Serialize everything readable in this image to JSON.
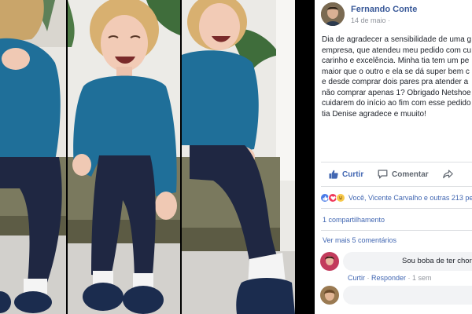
{
  "post": {
    "author": "Fernando Conte",
    "date": "14 de maio ·",
    "text_lines": [
      "Dia de agradecer a sensibilidade de uma g",
      "empresa, que atendeu meu pedido com cu",
      "carinho e excelência. Minha tia tem um pe",
      "maior que o outro e ela se dá super bem c",
      "e desde comprar dois pares pra atender a",
      "não comprar apenas 1? Obrigado Netshoe",
      "cuidarem do início ao fim com esse pedido",
      "tia Denise agradece e muuito!"
    ],
    "actions": {
      "like": "Curtir",
      "comment": "Comentar",
      "share": ""
    },
    "reactions_text": "Você, Vicente Carvalho e outras 213 pes",
    "shares": "1 compartilhamento",
    "more_comments": "Ver mais 5 comentários",
    "comments": [
      {
        "text": "Sou boba de ter chora",
        "like_label": "Curtir",
        "sep": " · ",
        "reply_label": "Responder",
        "time": " · 1 sem"
      },
      {
        "text": ""
      }
    ]
  },
  "colors": {
    "link_blue": "#4267b2",
    "author_blue": "#385898",
    "meta_gray": "#90949c",
    "action_gray": "#606770",
    "divider": "#dddfe2",
    "sweater": "#1f6f99",
    "jeans": "#1f2742",
    "hair": "#d8b070"
  },
  "icons": {
    "like": "thumbs-up-icon",
    "comment": "speech-bubble-icon",
    "share": "share-arrow-icon",
    "reaction_like": "reaction-like-icon",
    "reaction_love": "reaction-love-icon",
    "reaction_haha": "reaction-haha-icon"
  }
}
